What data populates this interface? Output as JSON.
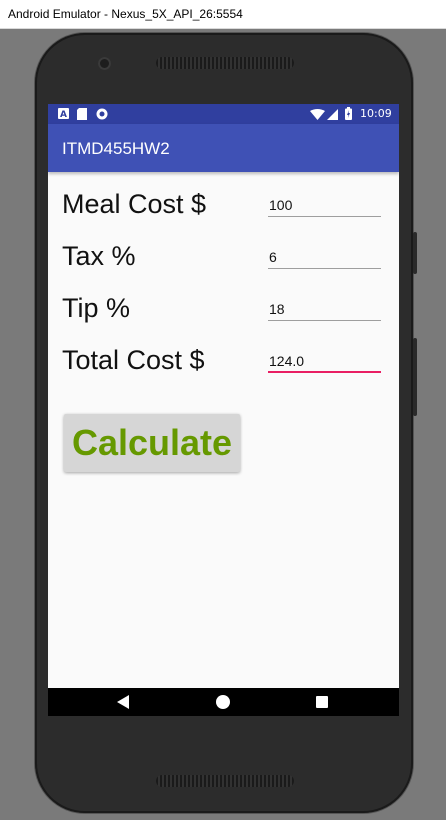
{
  "window": {
    "title": "Android Emulator - Nexus_5X_API_26:5554"
  },
  "statusbar": {
    "time": "10:09"
  },
  "app": {
    "title": "ITMD455HW2"
  },
  "form": {
    "meal_cost_label": "Meal Cost $",
    "meal_cost_value": "100",
    "tax_label": "Tax %",
    "tax_value": "6",
    "tip_label": "Tip %",
    "tip_value": "18",
    "total_label": "Total Cost $",
    "total_value": "124.0"
  },
  "calculate_label": "Calculate",
  "colors": {
    "statusbar": "#303f9f",
    "appbar": "#3f51b5",
    "button_text": "#669900",
    "active_underline": "#e91e63"
  },
  "icons": [
    "signal-icon",
    "sd-card-icon",
    "sync-icon",
    "wifi-icon",
    "cell-signal-icon",
    "battery-icon",
    "back-icon",
    "home-icon",
    "recents-icon"
  ]
}
